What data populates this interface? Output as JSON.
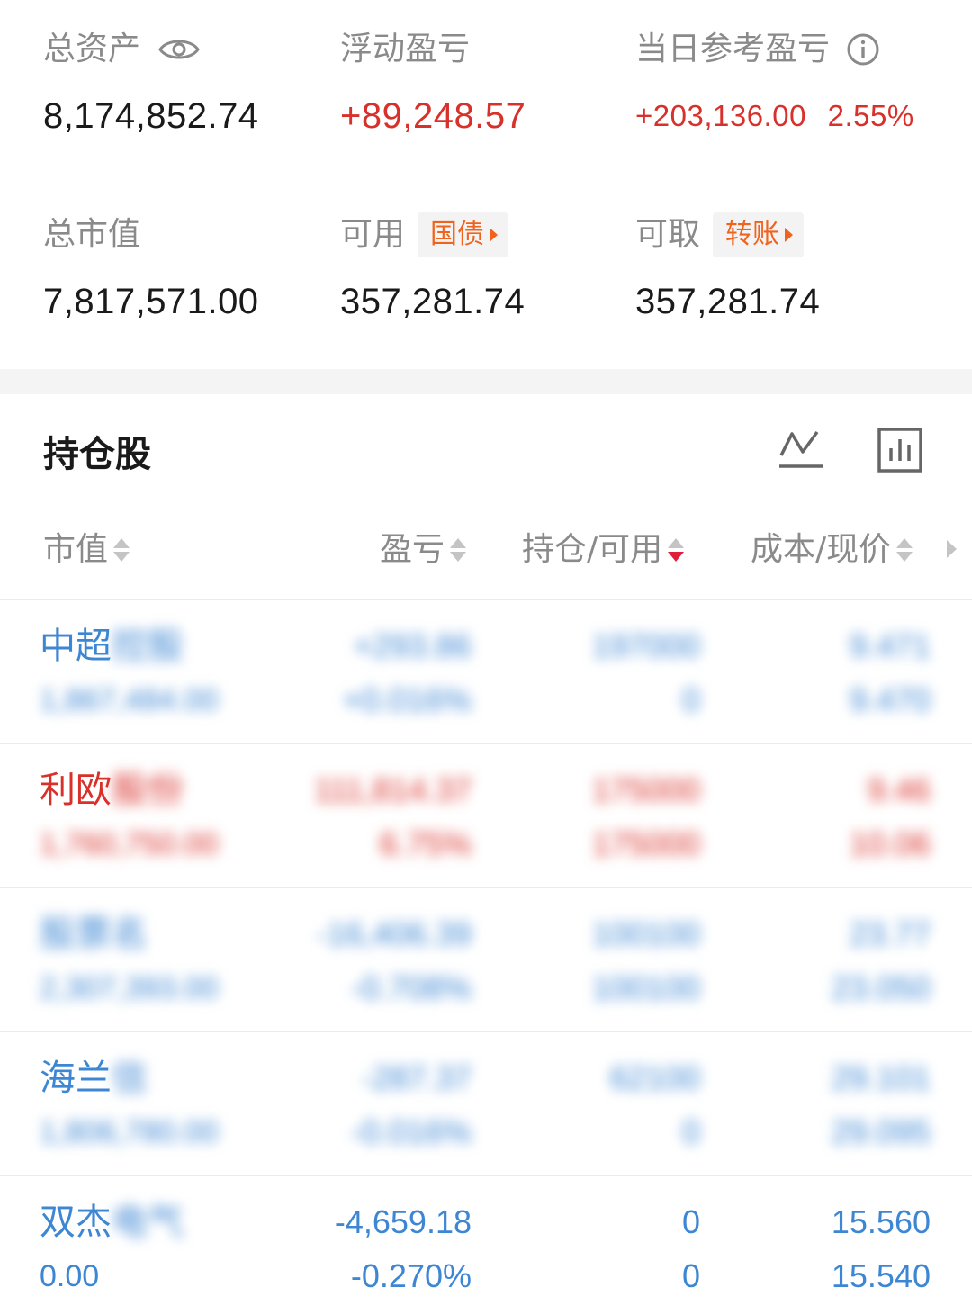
{
  "summary": {
    "total_assets_label": "总资产",
    "total_assets": "8,174,852.74",
    "floating_pl_label": "浮动盈亏",
    "floating_pl": "+89,248.57",
    "daily_pl_label": "当日参考盈亏",
    "daily_pl": "+203,136.00",
    "daily_pl_pct": "2.55%",
    "market_value_label": "总市值",
    "market_value": "7,817,571.00",
    "available_label": "可用",
    "available_tag": "国债",
    "available": "357,281.74",
    "withdrawable_label": "可取",
    "withdrawable_tag": "转账",
    "withdrawable": "357,281.74"
  },
  "holdings": {
    "title": "持仓股",
    "columns": [
      "市值",
      "盈亏",
      "持仓/可用",
      "成本/现价"
    ],
    "rows": [
      {
        "name": "中超",
        "name_hidden": "控股",
        "market_value": "1,867,484.00",
        "pl": "+293.86",
        "pl_pct": "+0.016%",
        "position": "197000",
        "available": "0",
        "cost": "9.471",
        "price": "9.470",
        "color": "blue"
      },
      {
        "name": "利欧",
        "name_hidden": "股份",
        "market_value": "1,760,750.00",
        "pl": "111,814.37",
        "pl_pct": "6.75%",
        "position": "175000",
        "available": "175000",
        "cost": "9.46",
        "price": "10.06",
        "color": "red"
      },
      {
        "name": "",
        "name_hidden": "股票名",
        "market_value": "2,307,393.00",
        "pl": "-16,406.39",
        "pl_pct": "-0.708%",
        "position": "100100",
        "available": "100100",
        "cost": "23.77",
        "price": "23.050",
        "color": "blue"
      },
      {
        "name": "海兰",
        "name_hidden": "信",
        "market_value": "1,806,780.00",
        "pl": "-287.37",
        "pl_pct": "-0.016%",
        "position": "62100",
        "available": "0",
        "cost": "29.101",
        "price": "29.095",
        "color": "blue"
      },
      {
        "name": "双杰",
        "name_hidden": "电气",
        "market_value": "0.00",
        "pl": "-4,659.18",
        "pl_pct": "-0.270%",
        "position": "0",
        "available": "0",
        "cost": "15.560",
        "price": "15.540",
        "color": "blue"
      }
    ]
  }
}
